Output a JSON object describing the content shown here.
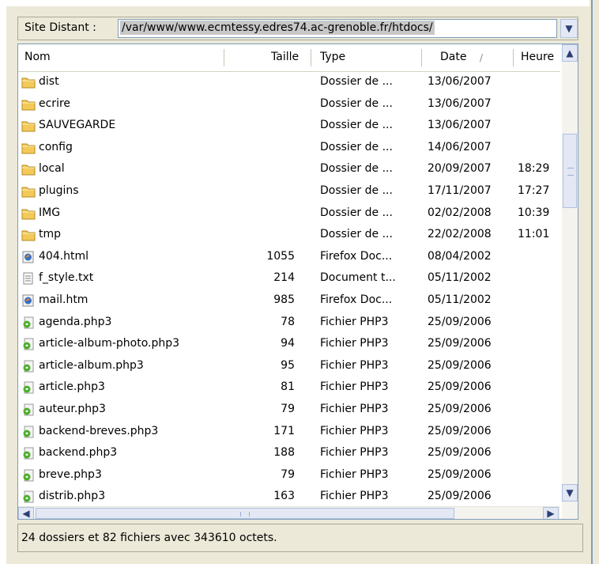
{
  "address": {
    "label": "Site Distant :",
    "path": "/var/www/www.ecmtessy.edres74.ac-grenoble.fr/htdocs/"
  },
  "columns": {
    "name": "Nom",
    "size": "Taille",
    "type": "Type",
    "date": "Date",
    "date_sort_indicator": "/",
    "time": "Heure"
  },
  "files": [
    {
      "icon": "folder-icon",
      "name": "dist",
      "size": "",
      "type": "Dossier de ...",
      "date": "13/06/2007",
      "time": ""
    },
    {
      "icon": "folder-icon",
      "name": "ecrire",
      "size": "",
      "type": "Dossier de ...",
      "date": "13/06/2007",
      "time": ""
    },
    {
      "icon": "folder-icon",
      "name": "SAUVEGARDE",
      "size": "",
      "type": "Dossier de ...",
      "date": "13/06/2007",
      "time": ""
    },
    {
      "icon": "folder-icon",
      "name": "config",
      "size": "",
      "type": "Dossier de ...",
      "date": "14/06/2007",
      "time": ""
    },
    {
      "icon": "folder-icon",
      "name": "local",
      "size": "",
      "type": "Dossier de ...",
      "date": "20/09/2007",
      "time": "18:29"
    },
    {
      "icon": "folder-icon",
      "name": "plugins",
      "size": "",
      "type": "Dossier de ...",
      "date": "17/11/2007",
      "time": "17:27"
    },
    {
      "icon": "folder-icon",
      "name": "IMG",
      "size": "",
      "type": "Dossier de ...",
      "date": "02/02/2008",
      "time": "10:39"
    },
    {
      "icon": "folder-icon",
      "name": "tmp",
      "size": "",
      "type": "Dossier de ...",
      "date": "22/02/2008",
      "time": "11:01"
    },
    {
      "icon": "firefox-doc-icon",
      "name": "404.html",
      "size": "1055",
      "type": "Firefox Doc...",
      "date": "08/04/2002",
      "time": ""
    },
    {
      "icon": "text-doc-icon",
      "name": "f_style.txt",
      "size": "214",
      "type": "Document t...",
      "date": "05/11/2002",
      "time": ""
    },
    {
      "icon": "firefox-doc-icon",
      "name": "mail.htm",
      "size": "985",
      "type": "Firefox Doc...",
      "date": "05/11/2002",
      "time": ""
    },
    {
      "icon": "php-file-icon",
      "name": "agenda.php3",
      "size": "78",
      "type": "Fichier PHP3",
      "date": "25/09/2006",
      "time": ""
    },
    {
      "icon": "php-file-icon",
      "name": "article-album-photo.php3",
      "size": "94",
      "type": "Fichier PHP3",
      "date": "25/09/2006",
      "time": ""
    },
    {
      "icon": "php-file-icon",
      "name": "article-album.php3",
      "size": "95",
      "type": "Fichier PHP3",
      "date": "25/09/2006",
      "time": ""
    },
    {
      "icon": "php-file-icon",
      "name": "article.php3",
      "size": "81",
      "type": "Fichier PHP3",
      "date": "25/09/2006",
      "time": ""
    },
    {
      "icon": "php-file-icon",
      "name": "auteur.php3",
      "size": "79",
      "type": "Fichier PHP3",
      "date": "25/09/2006",
      "time": ""
    },
    {
      "icon": "php-file-icon",
      "name": "backend-breves.php3",
      "size": "171",
      "type": "Fichier PHP3",
      "date": "25/09/2006",
      "time": ""
    },
    {
      "icon": "php-file-icon",
      "name": "backend.php3",
      "size": "188",
      "type": "Fichier PHP3",
      "date": "25/09/2006",
      "time": ""
    },
    {
      "icon": "php-file-icon",
      "name": "breve.php3",
      "size": "79",
      "type": "Fichier PHP3",
      "date": "25/09/2006",
      "time": ""
    },
    {
      "icon": "php-file-icon",
      "name": "distrib.php3",
      "size": "163",
      "type": "Fichier PHP3",
      "date": "25/09/2006",
      "time": ""
    }
  ],
  "status": "24 dossiers et 82 fichiers avec 343610 octets.",
  "colors": {
    "folder": "#f3c95a",
    "folder_stroke": "#b58a1e",
    "php_green": "#4caf2a",
    "firefox_blue": "#3a6fc4",
    "selection_gray": "#c8c8c8"
  }
}
